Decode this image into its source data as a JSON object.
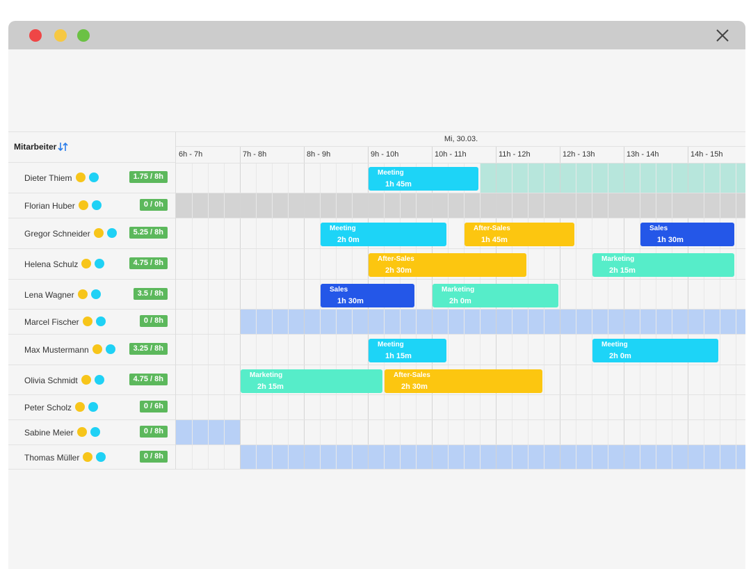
{
  "window": {
    "traffic_lights": [
      "#ef4646",
      "#f6c843",
      "#6bc144"
    ],
    "close_icon": "close-icon"
  },
  "header": {
    "employee_label": "Mitarbeiter",
    "sort_icon": "sort-arrows-icon",
    "date": "Mi, 30.03.",
    "hours": [
      "6h - 7h",
      "7h - 8h",
      "8h - 9h",
      "9h - 10h",
      "10h - 11h",
      "11h - 12h",
      "12h - 13h",
      "13h - 14h",
      "14h - 15h"
    ]
  },
  "colors": {
    "status_yellow": "#f7c51a",
    "status_cyan": "#1fd1f5",
    "badge_green": "#5cb85c",
    "meeting": "#1dd4f7",
    "after_sales": "#fcc610",
    "sales": "#2457e8",
    "marketing": "#56edc9",
    "band_teal": "#b7e6dc",
    "band_gray": "#d3d3d3",
    "band_blue": "#b8d0f6"
  },
  "employees": [
    {
      "name": "Dieter Thiem",
      "hours": "1.75 / 8h"
    },
    {
      "name": "Florian Huber",
      "hours": "0 / 0h"
    },
    {
      "name": "Gregor Schneider",
      "hours": "5.25 / 8h"
    },
    {
      "name": "Helena Schulz",
      "hours": "4.75 / 8h"
    },
    {
      "name": "Lena Wagner",
      "hours": "3.5 / 8h"
    },
    {
      "name": "Marcel Fischer",
      "hours": "0 / 8h"
    },
    {
      "name": "Max Mustermann",
      "hours": "3.25 / 8h"
    },
    {
      "name": "Olivia Schmidt",
      "hours": "4.75 / 8h"
    },
    {
      "name": "Peter Scholz",
      "hours": "0 / 6h"
    },
    {
      "name": "Sabine Meier",
      "hours": "0 / 8h"
    },
    {
      "name": "Thomas Müller",
      "hours": "0 / 8h"
    }
  ],
  "events": [
    {
      "row": 0,
      "title": "Meeting",
      "duration": "1h 45m",
      "kind": "meeting",
      "start": 9.0,
      "end": 10.75
    },
    {
      "row": 2,
      "title": "Meeting",
      "duration": "2h 0m",
      "kind": "meeting",
      "start": 8.25,
      "end": 10.25
    },
    {
      "row": 2,
      "title": "After-Sales",
      "duration": "1h 45m",
      "kind": "after_sales",
      "start": 10.5,
      "end": 12.25
    },
    {
      "row": 2,
      "title": "Sales",
      "duration": "1h 30m",
      "kind": "sales",
      "start": 13.25,
      "end": 14.75
    },
    {
      "row": 3,
      "title": "After-Sales",
      "duration": "2h 30m",
      "kind": "after_sales",
      "start": 9.0,
      "end": 11.5
    },
    {
      "row": 3,
      "title": "Marketing",
      "duration": "2h 15m",
      "kind": "marketing",
      "start": 12.5,
      "end": 14.75
    },
    {
      "row": 4,
      "title": "Sales",
      "duration": "1h 30m",
      "kind": "sales",
      "start": 8.25,
      "end": 9.75
    },
    {
      "row": 4,
      "title": "Marketing",
      "duration": "2h 0m",
      "kind": "marketing",
      "start": 10.0,
      "end": 12.0
    },
    {
      "row": 6,
      "title": "Meeting",
      "duration": "1h 15m",
      "kind": "meeting",
      "start": 9.0,
      "end": 10.25
    },
    {
      "row": 6,
      "title": "Meeting",
      "duration": "2h 0m",
      "kind": "meeting",
      "start": 12.5,
      "end": 14.5
    },
    {
      "row": 7,
      "title": "Marketing",
      "duration": "2h 15m",
      "kind": "marketing",
      "start": 7.0,
      "end": 9.25
    },
    {
      "row": 7,
      "title": "After-Sales",
      "duration": "2h 30m",
      "kind": "after_sales",
      "start": 9.25,
      "end": 11.75
    }
  ],
  "bands": [
    {
      "row": 0,
      "kind": "band_teal",
      "start": 10.75,
      "end": 15.0
    },
    {
      "row": 1,
      "kind": "band_gray",
      "start": 6.0,
      "end": 15.0
    },
    {
      "row": 5,
      "kind": "band_blue",
      "start": 7.0,
      "end": 15.0
    },
    {
      "row": 9,
      "kind": "band_blue",
      "start": 6.0,
      "end": 7.0
    },
    {
      "row": 10,
      "kind": "band_blue",
      "start": 7.0,
      "end": 15.0
    }
  ]
}
